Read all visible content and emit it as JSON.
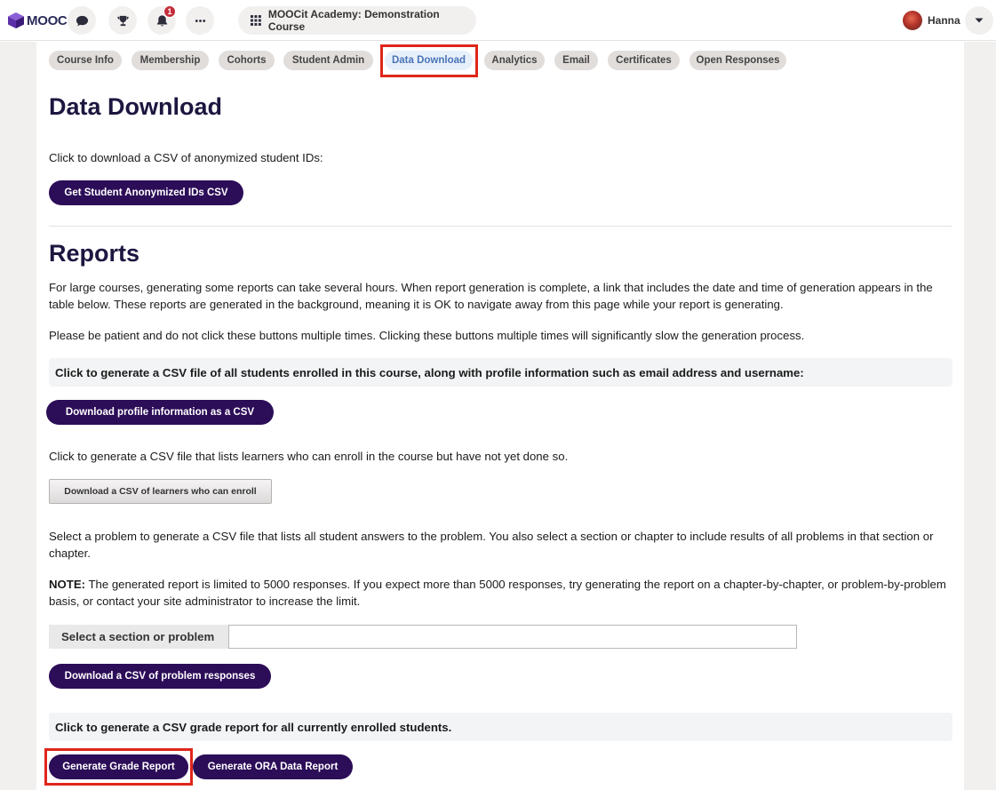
{
  "header": {
    "logo_text": "MOOC",
    "notification_count": "1",
    "course_title": "MOOCit Academy: Demonstration Course",
    "user_name": "Hanna"
  },
  "tabs": [
    {
      "label": "Course Info"
    },
    {
      "label": "Membership"
    },
    {
      "label": "Cohorts"
    },
    {
      "label": "Student Admin"
    },
    {
      "label": "Data Download",
      "active": true
    },
    {
      "label": "Analytics"
    },
    {
      "label": "Email"
    },
    {
      "label": "Certificates"
    },
    {
      "label": "Open Responses"
    }
  ],
  "data_download": {
    "title": "Data Download",
    "anon_text": "Click to download a CSV of anonymized student IDs:",
    "anon_button": "Get Student Anonymized IDs CSV"
  },
  "reports": {
    "title": "Reports",
    "intro": "For large courses, generating some reports can take several hours. When report generation is complete, a link that includes the date and time of generation appears in the table below. These reports are generated in the background, meaning it is OK to navigate away from this page while your report is generating.",
    "patience": "Please be patient and do not click these buttons multiple times. Clicking these buttons multiple times will significantly slow the generation process.",
    "profile_box": "Click to generate a CSV file of all students enrolled in this course, along with profile information such as email address and username:",
    "profile_button": "Download profile information as a CSV",
    "can_enroll_text": "Click to generate a CSV file that lists learners who can enroll in the course but have not yet done so.",
    "can_enroll_button": "Download a CSV of learners who can enroll",
    "problem_text": "Select a problem to generate a CSV file that lists all student answers to the problem. You also select a section or chapter to include results of all problems in that section or chapter.",
    "note_label": "NOTE:",
    "note_text": " The generated report is limited to 5000 responses. If you expect more than 5000 responses, try generating the report on a chapter-by-chapter, or problem-by-problem basis, or contact your site administrator to increase the limit.",
    "select_label": "Select a section or problem",
    "select_value": "",
    "problem_button": "Download a CSV of problem responses",
    "grade_box": "Click to generate a CSV grade report for all currently enrolled students.",
    "grade_button": "Generate Grade Report",
    "ora_button": "Generate ORA Data Report"
  },
  "colors": {
    "primary": "#2c0d58",
    "highlight": "#e0261b",
    "active_tab_text": "#4a74b8",
    "badge": "#c32d3a"
  }
}
